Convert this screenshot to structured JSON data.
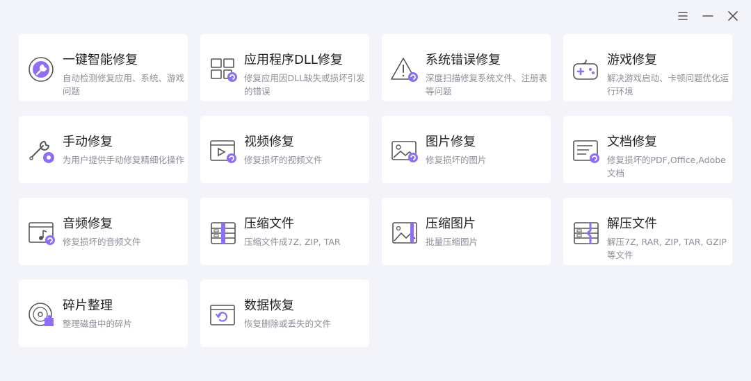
{
  "window_controls": {
    "menu_icon": "menu-icon",
    "minimize_icon": "minimize-icon",
    "close_icon": "close-icon"
  },
  "accent_color": "#8e6ef2",
  "cards": [
    {
      "id": "one-click-repair",
      "title": "一键智能修复",
      "desc": "自动检测修复应用、系统、游戏问题",
      "icon": "wrench-circle-icon"
    },
    {
      "id": "dll-repair",
      "title": "应用程序DLL修复",
      "desc": "修复应用因DLL缺失或损坏引发的错误",
      "icon": "dll-grid-icon"
    },
    {
      "id": "system-error-repair",
      "title": "系统错误修复",
      "desc": "深度扫描修复系统文件、注册表等问题",
      "icon": "warning-icon"
    },
    {
      "id": "game-repair",
      "title": "游戏修复",
      "desc": "解决游戏启动、卡顿问题优化运行环境",
      "icon": "gamepad-icon"
    },
    {
      "id": "manual-repair",
      "title": "手动修复",
      "desc": "为用户提供手动修复精细化操作",
      "icon": "wrench-gear-icon"
    },
    {
      "id": "video-repair",
      "title": "视频修复",
      "desc": "修复损坏的视频文件",
      "icon": "video-icon"
    },
    {
      "id": "image-repair",
      "title": "图片修复",
      "desc": "修复损坏的图片",
      "icon": "image-icon"
    },
    {
      "id": "document-repair",
      "title": "文档修复",
      "desc": "修复损坏的PDF,Office,Adobe文档",
      "icon": "document-icon"
    },
    {
      "id": "audio-repair",
      "title": "音频修复",
      "desc": "修复损坏的音频文件",
      "icon": "audio-icon"
    },
    {
      "id": "compress-files",
      "title": "压缩文件",
      "desc": "压缩文件成7Z, ZIP, TAR",
      "icon": "archive-icon"
    },
    {
      "id": "compress-images",
      "title": "压缩图片",
      "desc": "批量压缩图片",
      "icon": "compress-image-icon"
    },
    {
      "id": "extract-files",
      "title": "解压文件",
      "desc": "解压7Z, RAR, ZIP, TAR, GZIP等文件",
      "icon": "extract-icon"
    },
    {
      "id": "defragment",
      "title": "碎片整理",
      "desc": "整理磁盘中的碎片",
      "icon": "disk-puzzle-icon"
    },
    {
      "id": "data-recovery",
      "title": "数据恢复",
      "desc": "恢复删除或丢失的文件",
      "icon": "restore-icon"
    }
  ]
}
